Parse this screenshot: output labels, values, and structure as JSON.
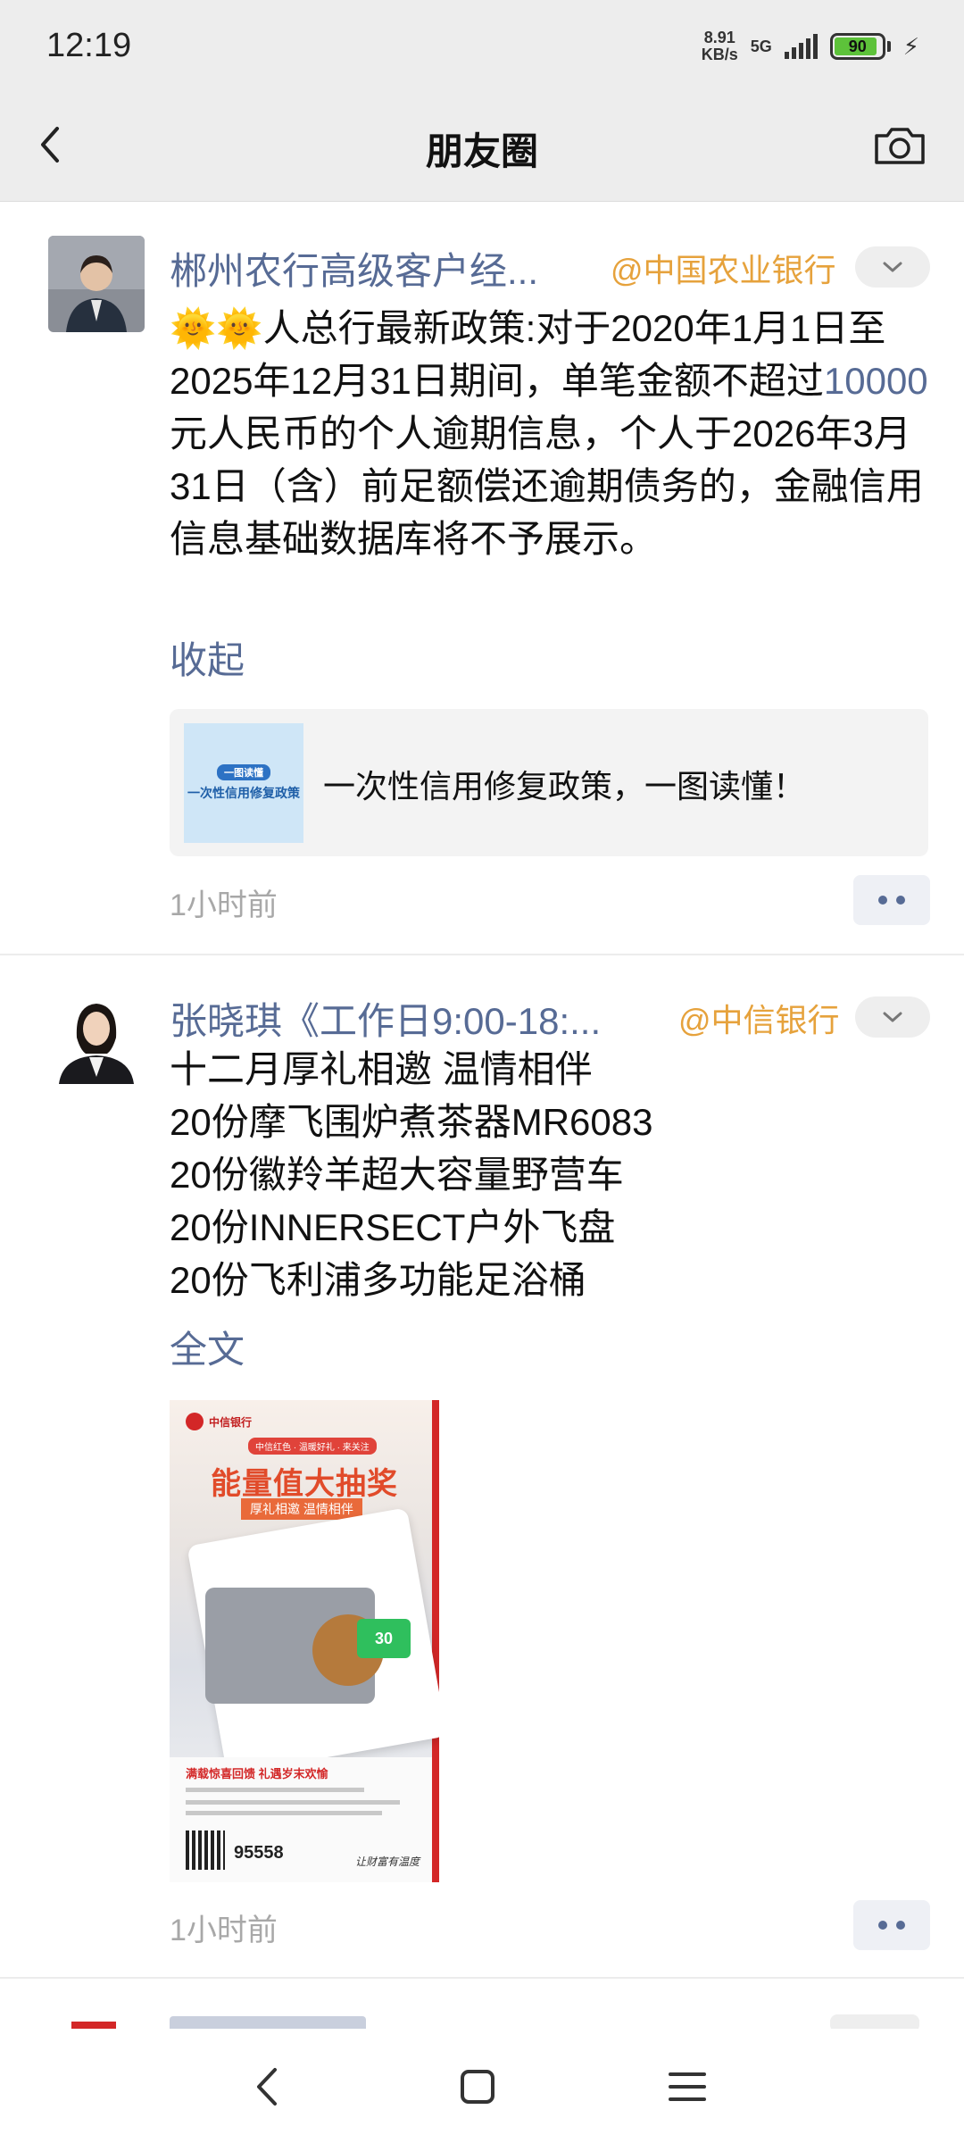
{
  "status_bar": {
    "time": "12:19",
    "net_speed_value": "8.91",
    "net_speed_unit": "KB/s",
    "net_type": "5G",
    "battery": "90",
    "battery_level": 0.9
  },
  "nav": {
    "title": "朋友圈"
  },
  "posts": [
    {
      "nickname": "郴州农行高级客户经...",
      "org": "@中国农业银行",
      "emoji": "🌞🌞",
      "text_before": "人总行最新政策:对于2020年1月1日至2025年12月31日期间，单笔金额不超过",
      "text_link": "10000",
      "text_after": "元人民币的个人逾期信息，个人于2026年3月31日（含）前足额偿还逾期债务的，金融信用信息基础数据库将不予展示。",
      "toggle": "收起",
      "link_card": {
        "thumb_tag": "一图读懂",
        "thumb_text": "一次性信用修复政策",
        "title": "一次性信用修复政策，一图读懂！"
      },
      "time": "1小时前"
    },
    {
      "nickname": "张晓琪《工作日9:00-18:...",
      "org": "@中信银行",
      "lines": [
        "十二月厚礼相邀 温情相伴",
        "20份摩飞围炉煮茶器MR6083",
        "20份徽羚羊超大容量野营车",
        "20份INNERSECT户外飞盘",
        "20份飞利浦多功能足浴桶"
      ],
      "toggle": "全文",
      "poster": {
        "bank": "中信银行",
        "tag": "中信红色 · 温暖好礼 · 来关注",
        "title": "能量值大抽奖",
        "subtitle": "厚礼相邀 温情相伴",
        "card_value": "30",
        "headline": "满载惊喜回馈 礼遇岁末欢愉",
        "phone": "95558",
        "slogan": "让财富有温度"
      },
      "time": "1小时前"
    }
  ]
}
